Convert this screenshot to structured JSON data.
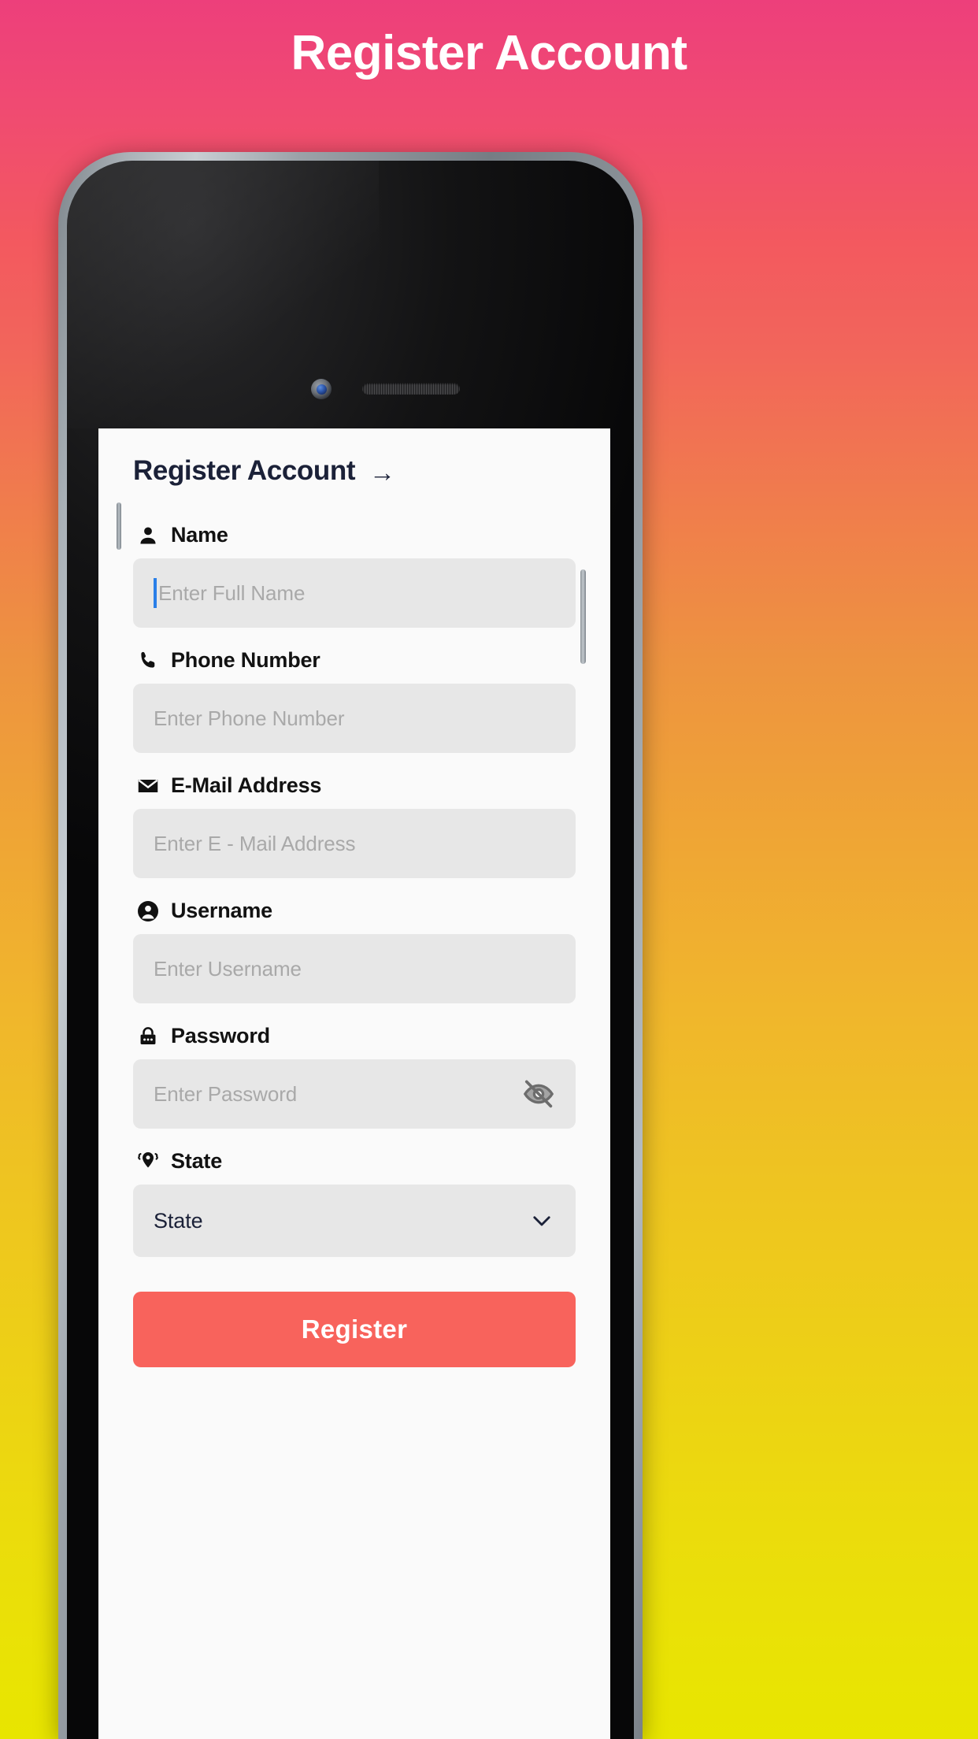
{
  "page": {
    "title": "Register Account"
  },
  "device": {
    "camera_label": "front-camera",
    "speaker_label": "earpiece-speaker"
  },
  "app": {
    "header": {
      "title": "Register Account",
      "arrow": "→"
    },
    "fields": [
      {
        "key": "name",
        "icon": "person-icon",
        "label": "Name",
        "placeholder": "Enter Full Name",
        "value": "",
        "focused": true
      },
      {
        "key": "phone",
        "icon": "phone-icon",
        "label": "Phone Number",
        "placeholder": "Enter Phone Number",
        "value": "",
        "focused": false
      },
      {
        "key": "email",
        "icon": "envelope-icon",
        "label": "E-Mail Address",
        "placeholder": "Enter E - Mail Address",
        "value": "",
        "focused": false
      },
      {
        "key": "username",
        "icon": "account-circle-icon",
        "label": "Username",
        "placeholder": "Enter Username",
        "value": "",
        "focused": false
      },
      {
        "key": "password",
        "icon": "lock-icon",
        "label": "Password",
        "placeholder": "Enter Password",
        "value": "",
        "focused": false,
        "toggle_icon": "eye-off-icon"
      },
      {
        "key": "state",
        "icon": "map-pin-icon",
        "label": "State",
        "selected": "State",
        "dropdown_icon": "chevron-down-icon"
      }
    ],
    "submit": {
      "label": "Register"
    }
  },
  "colors": {
    "accent_button": "#F8635C",
    "header_text": "#1b2138",
    "input_background": "#e7e7e7",
    "placeholder_text": "#a9a9a9",
    "caret": "#2a7fe8",
    "screen_background": "#fafafa",
    "gradient_top": "#ED3F7B",
    "gradient_bottom": "#E8E500"
  }
}
